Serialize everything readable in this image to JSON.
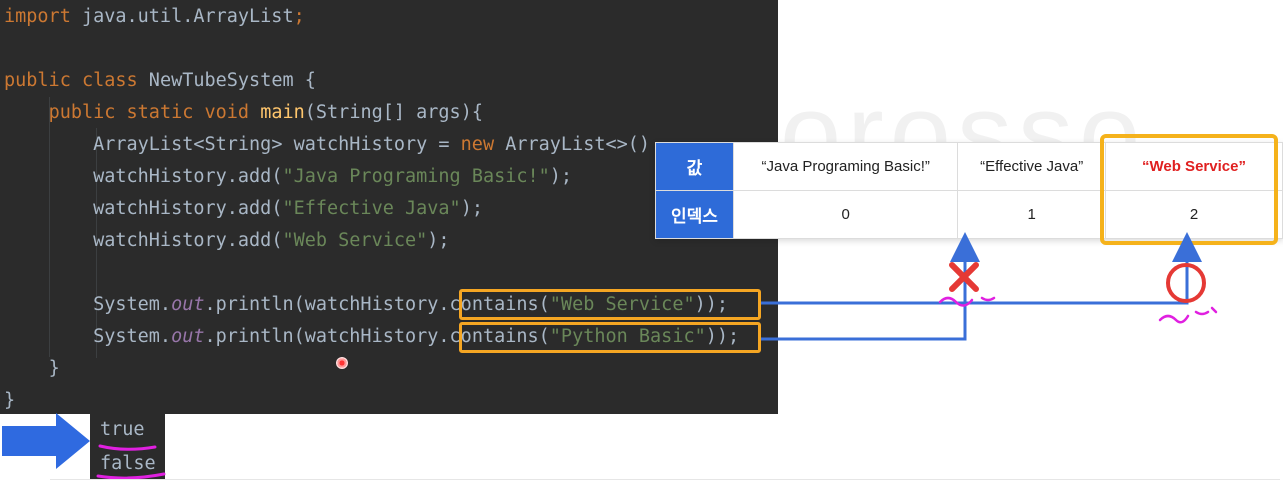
{
  "watermark": "orosso",
  "code": {
    "line1": {
      "kw": "import",
      "rest": " java.util.ArrayList",
      "semi": ";"
    },
    "line3": {
      "kw1": "public",
      "kw2": "class",
      "name": " NewTubeSystem {"
    },
    "line4": {
      "kw1": "public",
      "kw2": "static",
      "kw3": "void",
      "fn": "main",
      "rest": "(String[] args){"
    },
    "line5": {
      "a": "ArrayList<String> watchHistory = ",
      "kw": "new",
      "b": " ArrayList<>()"
    },
    "add_prefix": "watchHistory.add(",
    "add_suffix": ");",
    "add_args": [
      "\"Java Programing Basic!\"",
      "\"Effective Java\"",
      "\"Web Service\""
    ],
    "print_prefix": "System.",
    "print_out": "out",
    "print_mid": ".println(watchHistory",
    "contains_1": {
      "a": ".contains(",
      "arg": "\"Web Service\"",
      "b": "));"
    },
    "contains_2": {
      "a": ".contains(",
      "arg": "\"Python Basic\"",
      "b": "));"
    },
    "close_inner": "}",
    "close_outer": "}"
  },
  "output": [
    "true",
    "false"
  ],
  "array_table": {
    "value_header": "값",
    "index_header": "인덱스",
    "values": [
      "“Java Programing Basic!”",
      "“Effective Java”",
      "“Web Service”"
    ],
    "indexes": [
      "0",
      "1",
      "2"
    ]
  },
  "colors": {
    "editor_bg": "#2b2b2b",
    "keyword": "#cc7832",
    "string": "#6a8759",
    "method": "#ffc66d",
    "highlight": "#f5a623",
    "table_header": "#2e6bd8",
    "arrow_blue": "#3a6fd8",
    "mark_red": "#e53935",
    "underline_magenta": "#e020e0"
  }
}
